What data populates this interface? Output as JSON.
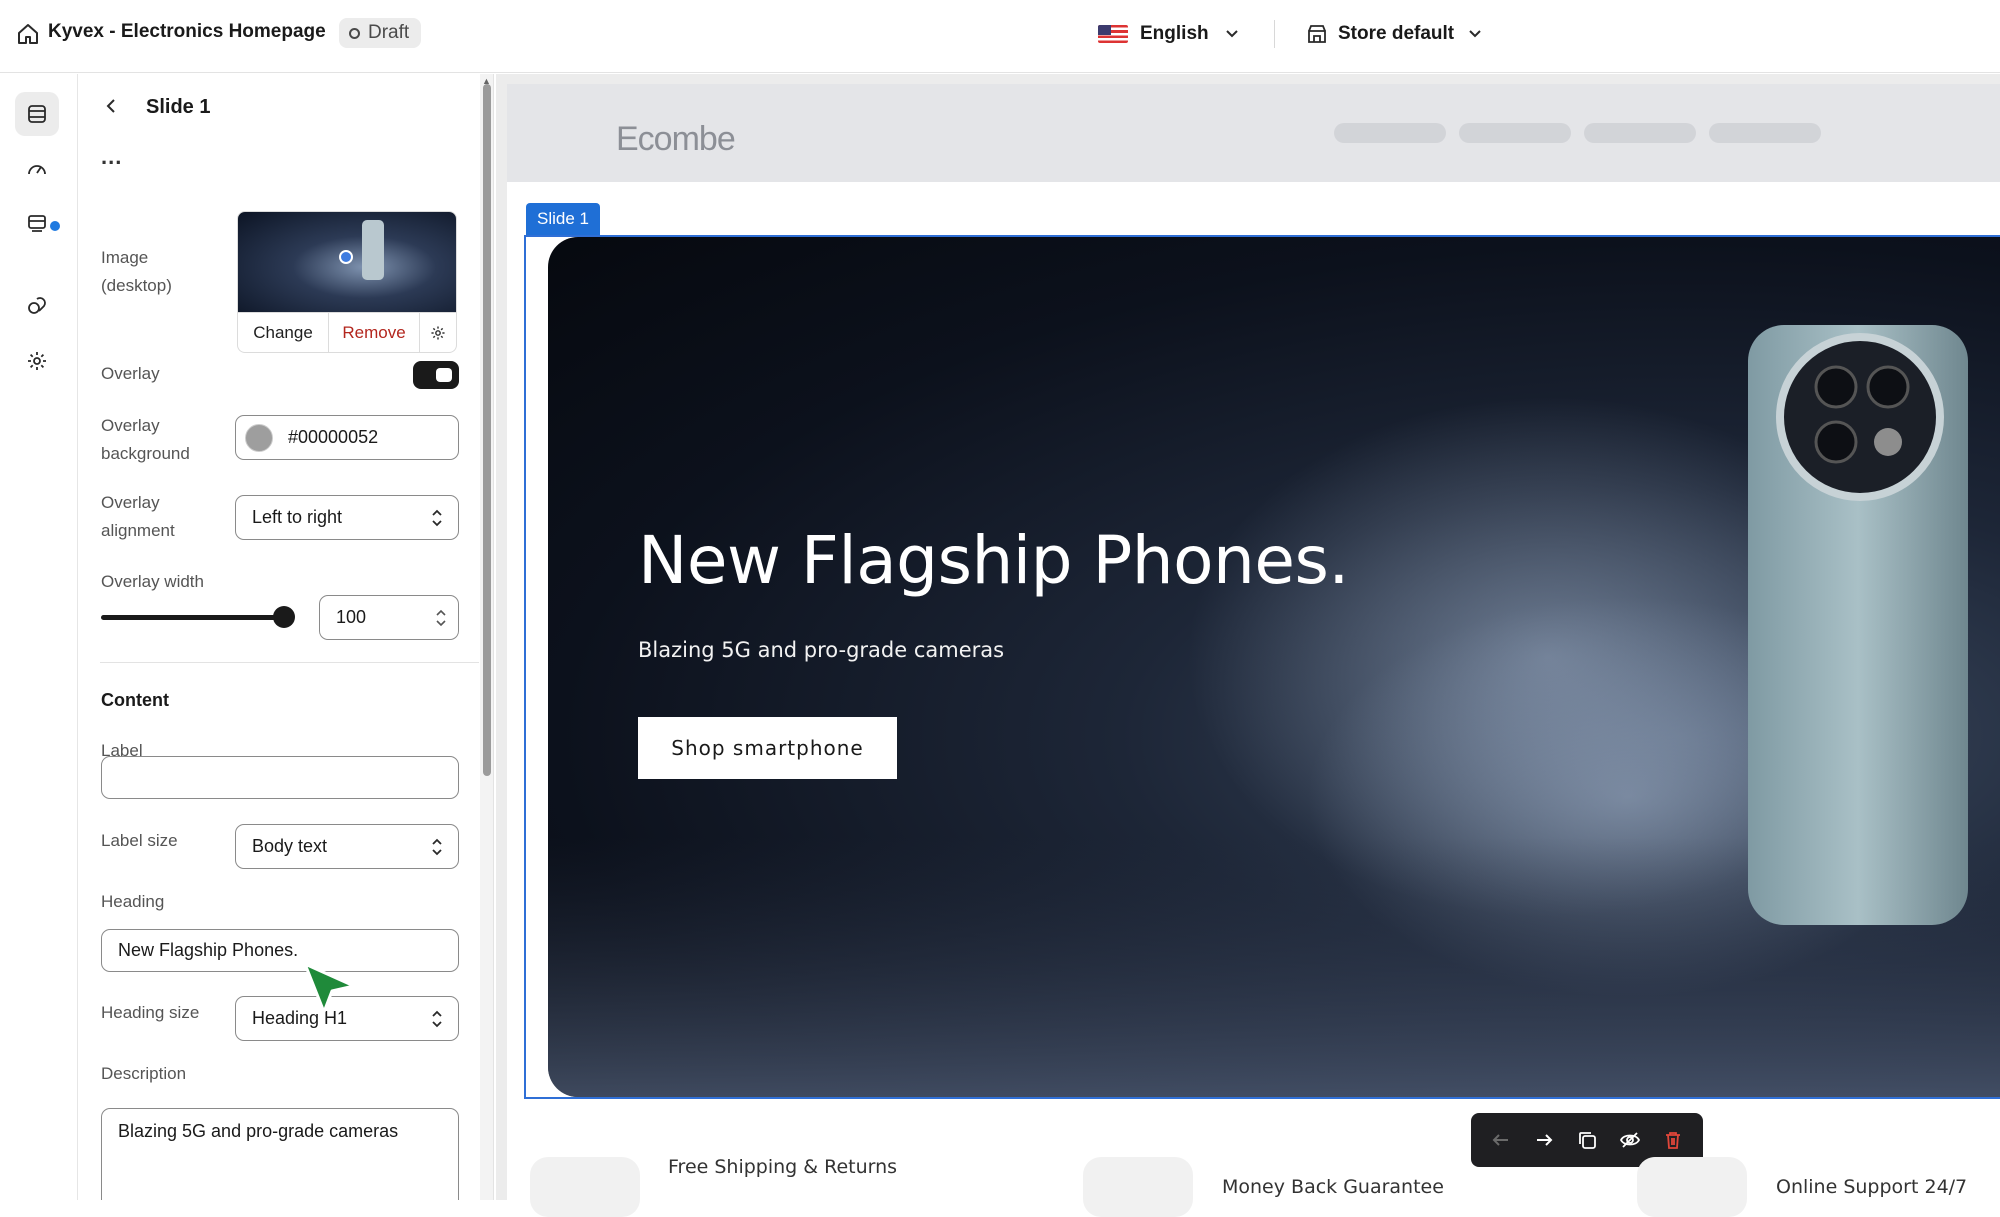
{
  "topbar": {
    "title": "Kyvex - Electronics Homepage",
    "status": "Draft",
    "language": "English",
    "store": "Store default"
  },
  "rail": {
    "icons": [
      "sections-icon",
      "speed-icon",
      "blocks-icon",
      "apps-icon",
      "settings-icon"
    ]
  },
  "panel": {
    "title": "Slide 1",
    "more": "...",
    "image_label": "Image (desktop)",
    "change": "Change",
    "remove": "Remove",
    "overlay_label": "Overlay",
    "overlay_on": true,
    "overlay_bg_label": "Overlay background",
    "overlay_bg_value": "#00000052",
    "overlay_align_label": "Overlay alignment",
    "overlay_align_value": "Left to right",
    "overlay_width_label": "Overlay width",
    "overlay_width_value": "100",
    "overlay_width_fraction": 1.0,
    "content_heading": "Content",
    "label_label": "Label",
    "label_value": "",
    "label_size_label": "Label size",
    "label_size_value": "Body text",
    "heading_label": "Heading",
    "heading_value": "New Flagship Phones.",
    "heading_size_label": "Heading size",
    "heading_size_value": "Heading H1",
    "description_label": "Description",
    "description_value": "Blazing 5G and pro-grade cameras"
  },
  "preview": {
    "logo": "Ecombe",
    "slide_tag": "Slide 1",
    "hero_heading": "New Flagship Phones.",
    "hero_desc": "Blazing 5G and pro-grade cameras",
    "hero_button": "Shop smartphone",
    "features": [
      "Free Shipping & Returns",
      "Money Back Guarantee",
      "Online Support 24/7"
    ]
  },
  "colors": {
    "accent": "#1f6fd6",
    "remove": "#b3261e",
    "toolbar_bg": "#1f1f22"
  }
}
